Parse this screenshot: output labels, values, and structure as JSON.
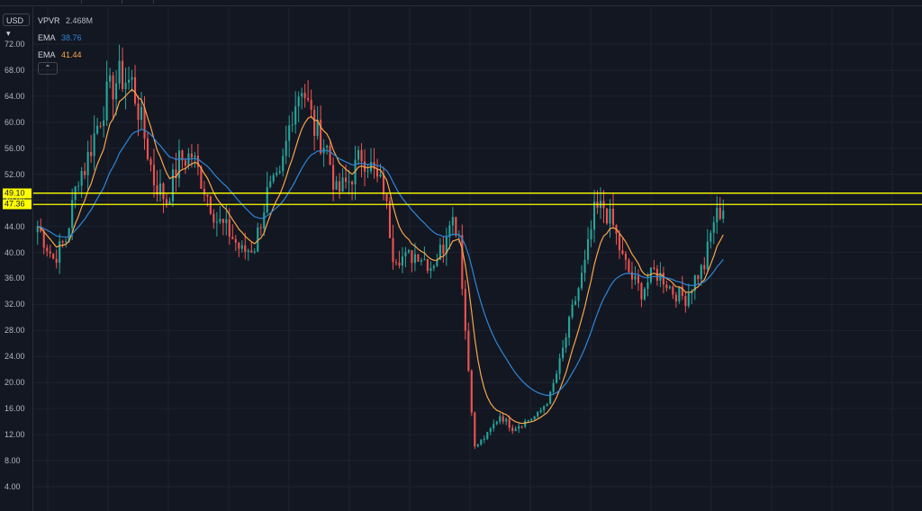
{
  "chart_data": {
    "type": "candlestick",
    "y_ticks": [
      "72.00",
      "68.00",
      "64.00",
      "60.00",
      "56.00",
      "52.00",
      "48.00",
      "44.00",
      "40.00",
      "36.00",
      "32.00",
      "28.00",
      "24.00",
      "20.00",
      "16.00",
      "12.00",
      "8.00",
      "4.00"
    ],
    "ylim": [
      2,
      76
    ],
    "grid": true,
    "horizontal_lines": [
      {
        "price": 49.1,
        "label": "49.10",
        "color": "#ffff00"
      },
      {
        "price": 47.36,
        "label": "47.36",
        "color": "#ffff00"
      }
    ],
    "anchors": [
      [
        0,
        44
      ],
      [
        5,
        39
      ],
      [
        9,
        42
      ],
      [
        13,
        52
      ],
      [
        15,
        53
      ],
      [
        18,
        58
      ],
      [
        22,
        64
      ],
      [
        26,
        67
      ],
      [
        30,
        66
      ],
      [
        33,
        60
      ],
      [
        37,
        51
      ],
      [
        41,
        48
      ],
      [
        45,
        54
      ],
      [
        49,
        55
      ],
      [
        53,
        50
      ],
      [
        57,
        45
      ],
      [
        61,
        43
      ],
      [
        65,
        40
      ],
      [
        69,
        41
      ],
      [
        73,
        49
      ],
      [
        77,
        51
      ],
      [
        81,
        62
      ],
      [
        84,
        66
      ],
      [
        88,
        59
      ],
      [
        92,
        56
      ],
      [
        95,
        49
      ],
      [
        99,
        51
      ],
      [
        103,
        55
      ],
      [
        105,
        54
      ],
      [
        108,
        51
      ],
      [
        110,
        50
      ],
      [
        113,
        40
      ],
      [
        117,
        39
      ],
      [
        121,
        40
      ],
      [
        125,
        38
      ],
      [
        129,
        41
      ],
      [
        131,
        46
      ],
      [
        134,
        43
      ],
      [
        136,
        28
      ],
      [
        139,
        10
      ],
      [
        143,
        12
      ],
      [
        147,
        15
      ],
      [
        151,
        13
      ],
      [
        155,
        14
      ],
      [
        159,
        15
      ],
      [
        163,
        18
      ],
      [
        166,
        23
      ],
      [
        170,
        31
      ],
      [
        174,
        38
      ],
      [
        177,
        46
      ],
      [
        180,
        47
      ],
      [
        183,
        44
      ],
      [
        186,
        39
      ],
      [
        189,
        36
      ],
      [
        192,
        34
      ],
      [
        196,
        37
      ],
      [
        199,
        36
      ],
      [
        202,
        34
      ],
      [
        206,
        33
      ],
      [
        209,
        36
      ],
      [
        212,
        38
      ],
      [
        215,
        45
      ],
      [
        218,
        47
      ]
    ],
    "ema_fast": {
      "value": "41.44",
      "color": "#f7a64a"
    },
    "ema_slow": {
      "value": "38.76",
      "color": "#2f86d6"
    },
    "up_color": "#26a69a",
    "down_color": "#ef5350"
  },
  "axis": {
    "currency": "USD"
  },
  "legend": {
    "vpvr_name": "VPVR",
    "vpvr_value": "2.468M",
    "ema1_name": "EMA",
    "ema1_value": "38.76",
    "ema2_name": "EMA",
    "ema2_value": "41.44",
    "collapse_icon": "chevron-up-icon"
  }
}
